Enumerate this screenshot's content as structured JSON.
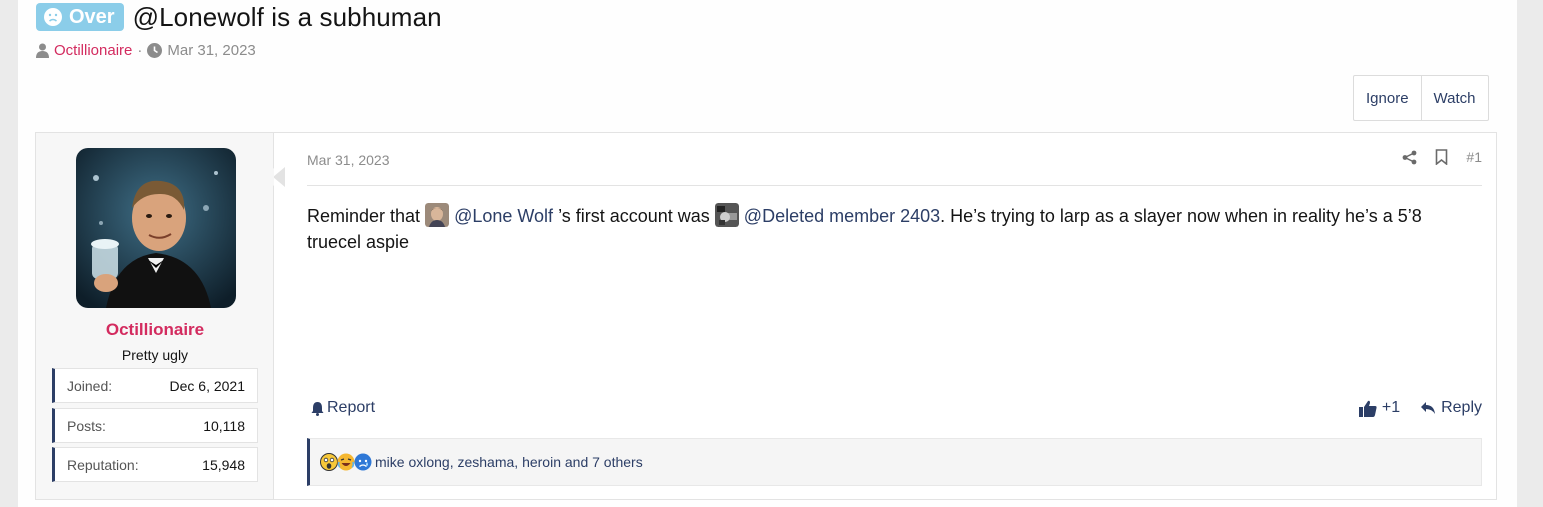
{
  "thread": {
    "prefix": "Over",
    "title": "@Lonewolf is a subhuman",
    "author": "Octillionaire",
    "separator": "·",
    "date": "Mar 31, 2023"
  },
  "actions": {
    "ignore_label": "Ignore",
    "watch_label": "Watch"
  },
  "user": {
    "name": "Octillionaire",
    "title": "Pretty ugly",
    "stats": [
      {
        "label": "Joined:",
        "value": "Dec 6, 2021"
      },
      {
        "label": "Posts:",
        "value": "10,118"
      },
      {
        "label": "Reputation:",
        "value": "15,948"
      }
    ]
  },
  "post": {
    "date": "Mar 31, 2023",
    "number": "#1",
    "body_start": "Reminder that ",
    "mention1": "@Lone Wolf",
    "body_mid": " ’s first account was ",
    "mention2": "@Deleted member 2403",
    "body_end": ". He’s trying to larp as a slayer now when in reality he’s a 5’8 truecel aspie"
  },
  "footer": {
    "report_label": "Report",
    "like_label": "+1",
    "reply_label": "Reply",
    "reactions_text": "mike oxlong, zeshama, heroin and 7 others"
  },
  "colors": {
    "accent": "#2c3e66",
    "username": "#d32b5f",
    "prefix_bg": "#8bcde9"
  },
  "icons": [
    "sad-face-icon",
    "user-icon",
    "clock-icon",
    "share-icon",
    "bookmark-icon",
    "bell-icon",
    "thumbs-up-icon",
    "reply-icon",
    "shocked-emoji-icon",
    "laughing-emoji-icon",
    "sad-emoji-icon"
  ]
}
